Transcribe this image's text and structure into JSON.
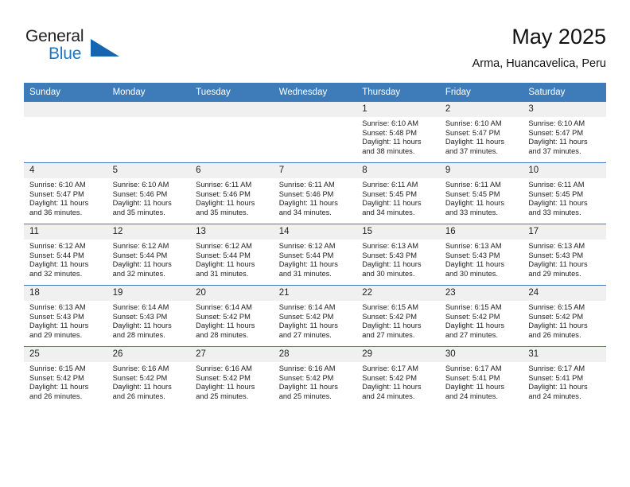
{
  "brand": {
    "name_top": "General",
    "name_bottom": "Blue",
    "accent_color": "#1f77c4",
    "triangle_color": "#1565b0"
  },
  "header": {
    "title": "May 2025",
    "subtitle": "Arma, Huancavelica, Peru"
  },
  "theme": {
    "header_bg": "#3d7cb8",
    "daynum_bg": "#f0f0f0",
    "grid_line": "#3d7cb8",
    "text": "#222222"
  },
  "labels": {
    "sunrise_prefix": "Sunrise:",
    "sunset_prefix": "Sunset:",
    "daylight_prefix": "Daylight:"
  },
  "weekdays": [
    "Sunday",
    "Monday",
    "Tuesday",
    "Wednesday",
    "Thursday",
    "Friday",
    "Saturday"
  ],
  "weeks": [
    [
      {
        "day": "",
        "empty": true
      },
      {
        "day": "",
        "empty": true
      },
      {
        "day": "",
        "empty": true
      },
      {
        "day": "",
        "empty": true
      },
      {
        "day": "1",
        "sunrise": "Sunrise: 6:10 AM",
        "sunset": "Sunset: 5:48 PM",
        "daylight": "Daylight: 11 hours and 38 minutes."
      },
      {
        "day": "2",
        "sunrise": "Sunrise: 6:10 AM",
        "sunset": "Sunset: 5:47 PM",
        "daylight": "Daylight: 11 hours and 37 minutes."
      },
      {
        "day": "3",
        "sunrise": "Sunrise: 6:10 AM",
        "sunset": "Sunset: 5:47 PM",
        "daylight": "Daylight: 11 hours and 37 minutes."
      }
    ],
    [
      {
        "day": "4",
        "sunrise": "Sunrise: 6:10 AM",
        "sunset": "Sunset: 5:47 PM",
        "daylight": "Daylight: 11 hours and 36 minutes."
      },
      {
        "day": "5",
        "sunrise": "Sunrise: 6:10 AM",
        "sunset": "Sunset: 5:46 PM",
        "daylight": "Daylight: 11 hours and 35 minutes."
      },
      {
        "day": "6",
        "sunrise": "Sunrise: 6:11 AM",
        "sunset": "Sunset: 5:46 PM",
        "daylight": "Daylight: 11 hours and 35 minutes."
      },
      {
        "day": "7",
        "sunrise": "Sunrise: 6:11 AM",
        "sunset": "Sunset: 5:46 PM",
        "daylight": "Daylight: 11 hours and 34 minutes."
      },
      {
        "day": "8",
        "sunrise": "Sunrise: 6:11 AM",
        "sunset": "Sunset: 5:45 PM",
        "daylight": "Daylight: 11 hours and 34 minutes."
      },
      {
        "day": "9",
        "sunrise": "Sunrise: 6:11 AM",
        "sunset": "Sunset: 5:45 PM",
        "daylight": "Daylight: 11 hours and 33 minutes."
      },
      {
        "day": "10",
        "sunrise": "Sunrise: 6:11 AM",
        "sunset": "Sunset: 5:45 PM",
        "daylight": "Daylight: 11 hours and 33 minutes."
      }
    ],
    [
      {
        "day": "11",
        "sunrise": "Sunrise: 6:12 AM",
        "sunset": "Sunset: 5:44 PM",
        "daylight": "Daylight: 11 hours and 32 minutes."
      },
      {
        "day": "12",
        "sunrise": "Sunrise: 6:12 AM",
        "sunset": "Sunset: 5:44 PM",
        "daylight": "Daylight: 11 hours and 32 minutes."
      },
      {
        "day": "13",
        "sunrise": "Sunrise: 6:12 AM",
        "sunset": "Sunset: 5:44 PM",
        "daylight": "Daylight: 11 hours and 31 minutes."
      },
      {
        "day": "14",
        "sunrise": "Sunrise: 6:12 AM",
        "sunset": "Sunset: 5:44 PM",
        "daylight": "Daylight: 11 hours and 31 minutes."
      },
      {
        "day": "15",
        "sunrise": "Sunrise: 6:13 AM",
        "sunset": "Sunset: 5:43 PM",
        "daylight": "Daylight: 11 hours and 30 minutes."
      },
      {
        "day": "16",
        "sunrise": "Sunrise: 6:13 AM",
        "sunset": "Sunset: 5:43 PM",
        "daylight": "Daylight: 11 hours and 30 minutes."
      },
      {
        "day": "17",
        "sunrise": "Sunrise: 6:13 AM",
        "sunset": "Sunset: 5:43 PM",
        "daylight": "Daylight: 11 hours and 29 minutes."
      }
    ],
    [
      {
        "day": "18",
        "sunrise": "Sunrise: 6:13 AM",
        "sunset": "Sunset: 5:43 PM",
        "daylight": "Daylight: 11 hours and 29 minutes."
      },
      {
        "day": "19",
        "sunrise": "Sunrise: 6:14 AM",
        "sunset": "Sunset: 5:43 PM",
        "daylight": "Daylight: 11 hours and 28 minutes."
      },
      {
        "day": "20",
        "sunrise": "Sunrise: 6:14 AM",
        "sunset": "Sunset: 5:42 PM",
        "daylight": "Daylight: 11 hours and 28 minutes."
      },
      {
        "day": "21",
        "sunrise": "Sunrise: 6:14 AM",
        "sunset": "Sunset: 5:42 PM",
        "daylight": "Daylight: 11 hours and 27 minutes."
      },
      {
        "day": "22",
        "sunrise": "Sunrise: 6:15 AM",
        "sunset": "Sunset: 5:42 PM",
        "daylight": "Daylight: 11 hours and 27 minutes."
      },
      {
        "day": "23",
        "sunrise": "Sunrise: 6:15 AM",
        "sunset": "Sunset: 5:42 PM",
        "daylight": "Daylight: 11 hours and 27 minutes."
      },
      {
        "day": "24",
        "sunrise": "Sunrise: 6:15 AM",
        "sunset": "Sunset: 5:42 PM",
        "daylight": "Daylight: 11 hours and 26 minutes."
      }
    ],
    [
      {
        "day": "25",
        "sunrise": "Sunrise: 6:15 AM",
        "sunset": "Sunset: 5:42 PM",
        "daylight": "Daylight: 11 hours and 26 minutes."
      },
      {
        "day": "26",
        "sunrise": "Sunrise: 6:16 AM",
        "sunset": "Sunset: 5:42 PM",
        "daylight": "Daylight: 11 hours and 26 minutes."
      },
      {
        "day": "27",
        "sunrise": "Sunrise: 6:16 AM",
        "sunset": "Sunset: 5:42 PM",
        "daylight": "Daylight: 11 hours and 25 minutes."
      },
      {
        "day": "28",
        "sunrise": "Sunrise: 6:16 AM",
        "sunset": "Sunset: 5:42 PM",
        "daylight": "Daylight: 11 hours and 25 minutes."
      },
      {
        "day": "29",
        "sunrise": "Sunrise: 6:17 AM",
        "sunset": "Sunset: 5:42 PM",
        "daylight": "Daylight: 11 hours and 24 minutes."
      },
      {
        "day": "30",
        "sunrise": "Sunrise: 6:17 AM",
        "sunset": "Sunset: 5:41 PM",
        "daylight": "Daylight: 11 hours and 24 minutes."
      },
      {
        "day": "31",
        "sunrise": "Sunrise: 6:17 AM",
        "sunset": "Sunset: 5:41 PM",
        "daylight": "Daylight: 11 hours and 24 minutes."
      }
    ]
  ]
}
